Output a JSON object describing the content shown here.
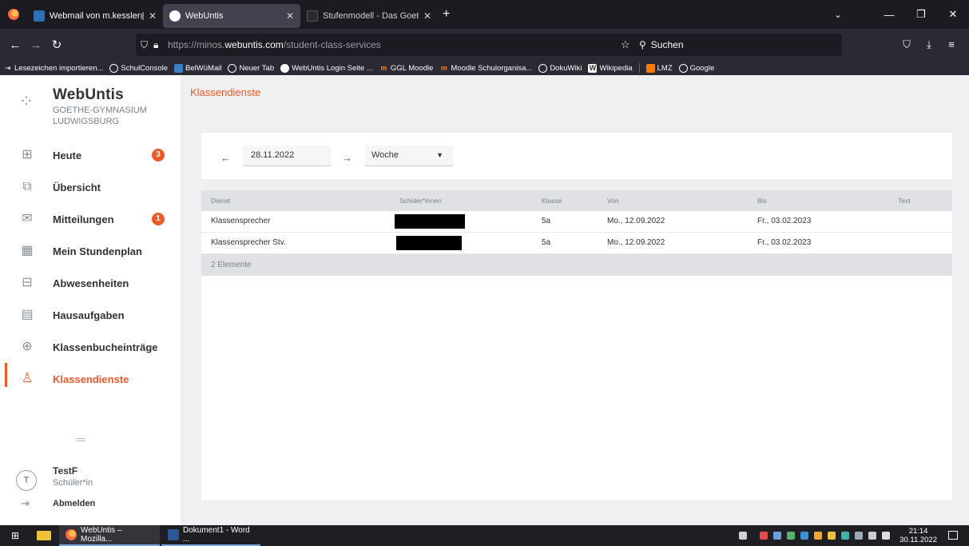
{
  "browser": {
    "tabs": [
      {
        "title": "Webmail von m.kessler@goeth"
      },
      {
        "title": "WebUntis"
      },
      {
        "title": "Stufenmodell - Das Goethe-Gy"
      }
    ],
    "url_prefix": "https://minos.",
    "url_domain": "webuntis.com",
    "url_path": "/student-class-services",
    "search_placeholder": "Suchen",
    "bookmarks": [
      {
        "label": "Lesezeichen importieren...",
        "icon": "import-icon"
      },
      {
        "label": "SchulConsole",
        "icon": "globe-icon"
      },
      {
        "label": "BelWüMail",
        "icon": "mail-icon"
      },
      {
        "label": "Neuer Tab",
        "icon": "globe-icon"
      },
      {
        "label": "WebUntis Login Seite ...",
        "icon": "webuntis-icon"
      },
      {
        "label": "GGL Moodle",
        "icon": "moodle-icon"
      },
      {
        "label": "Moodle Schulorganisa...",
        "icon": "moodle-icon"
      },
      {
        "label": "DokuWiki",
        "icon": "globe-icon"
      },
      {
        "label": "Wikipedia",
        "icon": "wiki-icon"
      },
      {
        "label": "LMZ",
        "icon": "lmz-icon"
      },
      {
        "label": "Google",
        "icon": "globe-icon"
      }
    ]
  },
  "sidebar": {
    "brand_name": "WebUntis",
    "school_line1": "GOETHE-GYMNASIUM",
    "school_line2": "LUDWIGSBURG",
    "items": [
      {
        "label": "Heute",
        "badge": "3",
        "icon": "dashboard-icon"
      },
      {
        "label": "Übersicht",
        "badge": "",
        "icon": "overview-icon"
      },
      {
        "label": "Mitteilungen",
        "badge": "1",
        "icon": "mail-icon"
      },
      {
        "label": "Mein Stundenplan",
        "badge": "",
        "icon": "calendar-icon"
      },
      {
        "label": "Abwesenheiten",
        "badge": "",
        "icon": "absence-icon"
      },
      {
        "label": "Hausaufgaben",
        "badge": "",
        "icon": "homework-icon"
      },
      {
        "label": "Klassenbucheinträge",
        "badge": "",
        "icon": "classbook-icon"
      },
      {
        "label": "Klassendienste",
        "badge": "",
        "icon": "class-services-icon"
      }
    ],
    "user_initial": "T",
    "user_name": "TestF",
    "user_role": "Schüler*in",
    "logout_label": "Abmelden"
  },
  "main": {
    "page_title": "Klassendienste",
    "date_value": "28.11.2022",
    "period_value": "Woche",
    "table": {
      "headers": [
        "Dienst",
        "Schüler*innen",
        "Klasse",
        "Von",
        "Bis",
        "Text"
      ],
      "rows": [
        {
          "dienst": "Klassensprecher",
          "klasse": "5a",
          "von": "Mo., 12.09.2022",
          "bis": "Fr., 03.02.2023",
          "text": ""
        },
        {
          "dienst": "Klassensprecher Stv.",
          "klasse": "5a",
          "von": "Mo., 12.09.2022",
          "bis": "Fr., 03.02.2023",
          "text": ""
        }
      ],
      "footer": "2 Elemente"
    }
  },
  "taskbar": {
    "tasks": [
      {
        "label": "WebUntis – Mozilla..."
      },
      {
        "label": "Dokument1 - Word ..."
      }
    ],
    "time": "21:14",
    "date": "30.11.2022"
  },
  "colors": {
    "accent": "#f05a28",
    "sidebar_bg": "#ffffff",
    "content_bg": "#eef0f2",
    "browser_dark": "#1c1b22"
  }
}
